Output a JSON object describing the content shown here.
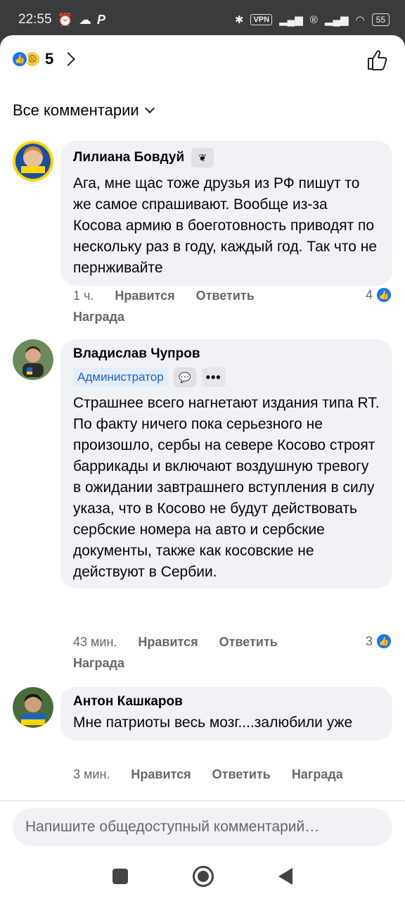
{
  "status_bar": {
    "time": "22:55",
    "vpn": "VPN",
    "battery": "55"
  },
  "header": {
    "reaction_count": "5",
    "filter_label": "Все комментарии"
  },
  "comments": [
    {
      "author": "Лилиана Бовдуй",
      "text": "Ага, мне щас тоже друзья из РФ пишут то же самое спрашивают. Вообще из-за Косова армию в боеготовность приводят по нескольку раз в году, каждый год. Так что не пернживайте",
      "time": "1 ч.",
      "like_label": "Нравится",
      "reply_label": "Ответить",
      "award_label": "Награда",
      "likes": "4"
    },
    {
      "author": "Владислав Чупров",
      "role": "Администратор",
      "text": "Страшнее всего нагнетают издания типа RT.\nПо факту ничего пока серьезного не произошло, сербы на севере Косово строят баррикады и включают воздушную тревогу в ожидании завтрашнего вступления в силу указа, что в Косово не будут действовать сербские номера на авто и сербские документы, также как косовские не действуют в Сербии.",
      "time": "43 мин.",
      "like_label": "Нравится",
      "reply_label": "Ответить",
      "award_label": "Награда",
      "likes": "3"
    },
    {
      "author": "Антон Кашкаров",
      "text": "Мне патриоты весь мозг....залюбили уже",
      "time": "3 мин.",
      "like_label": "Нравится",
      "reply_label": "Ответить",
      "award_label": "Награда"
    }
  ],
  "composer": {
    "placeholder": "Напишите общедоступный комментарий…"
  }
}
